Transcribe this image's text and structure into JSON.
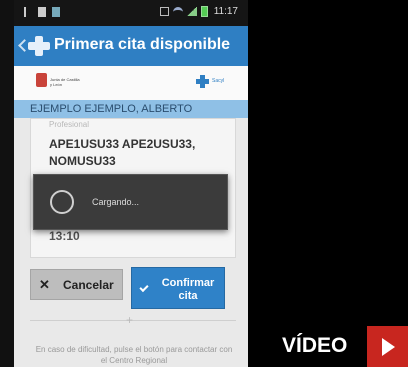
{
  "status_bar": {
    "time": "11:17"
  },
  "action_bar": {
    "title": "Primera cita disponible"
  },
  "logos": {
    "left_logo_text": "Junta de Castilla y León",
    "right_logo_text": "Sacyl"
  },
  "patient": {
    "name": "EJEMPLO EJEMPLO, ALBERTO"
  },
  "appointment": {
    "label": "Profesional",
    "professional": "APE1USU33 APE2USU33, NOMUSU33",
    "time": "13:10"
  },
  "loading": {
    "text": "Cargando..."
  },
  "buttons": {
    "cancel": "Cancelar",
    "confirm": "Confirmar cita"
  },
  "help": {
    "text": "En caso de dificultad, pulse el botón para contactar con el Centro Regional"
  },
  "video": {
    "label": "VÍDEO"
  },
  "colors": {
    "accent": "#2f7fc3",
    "video_red": "#c8261f"
  }
}
